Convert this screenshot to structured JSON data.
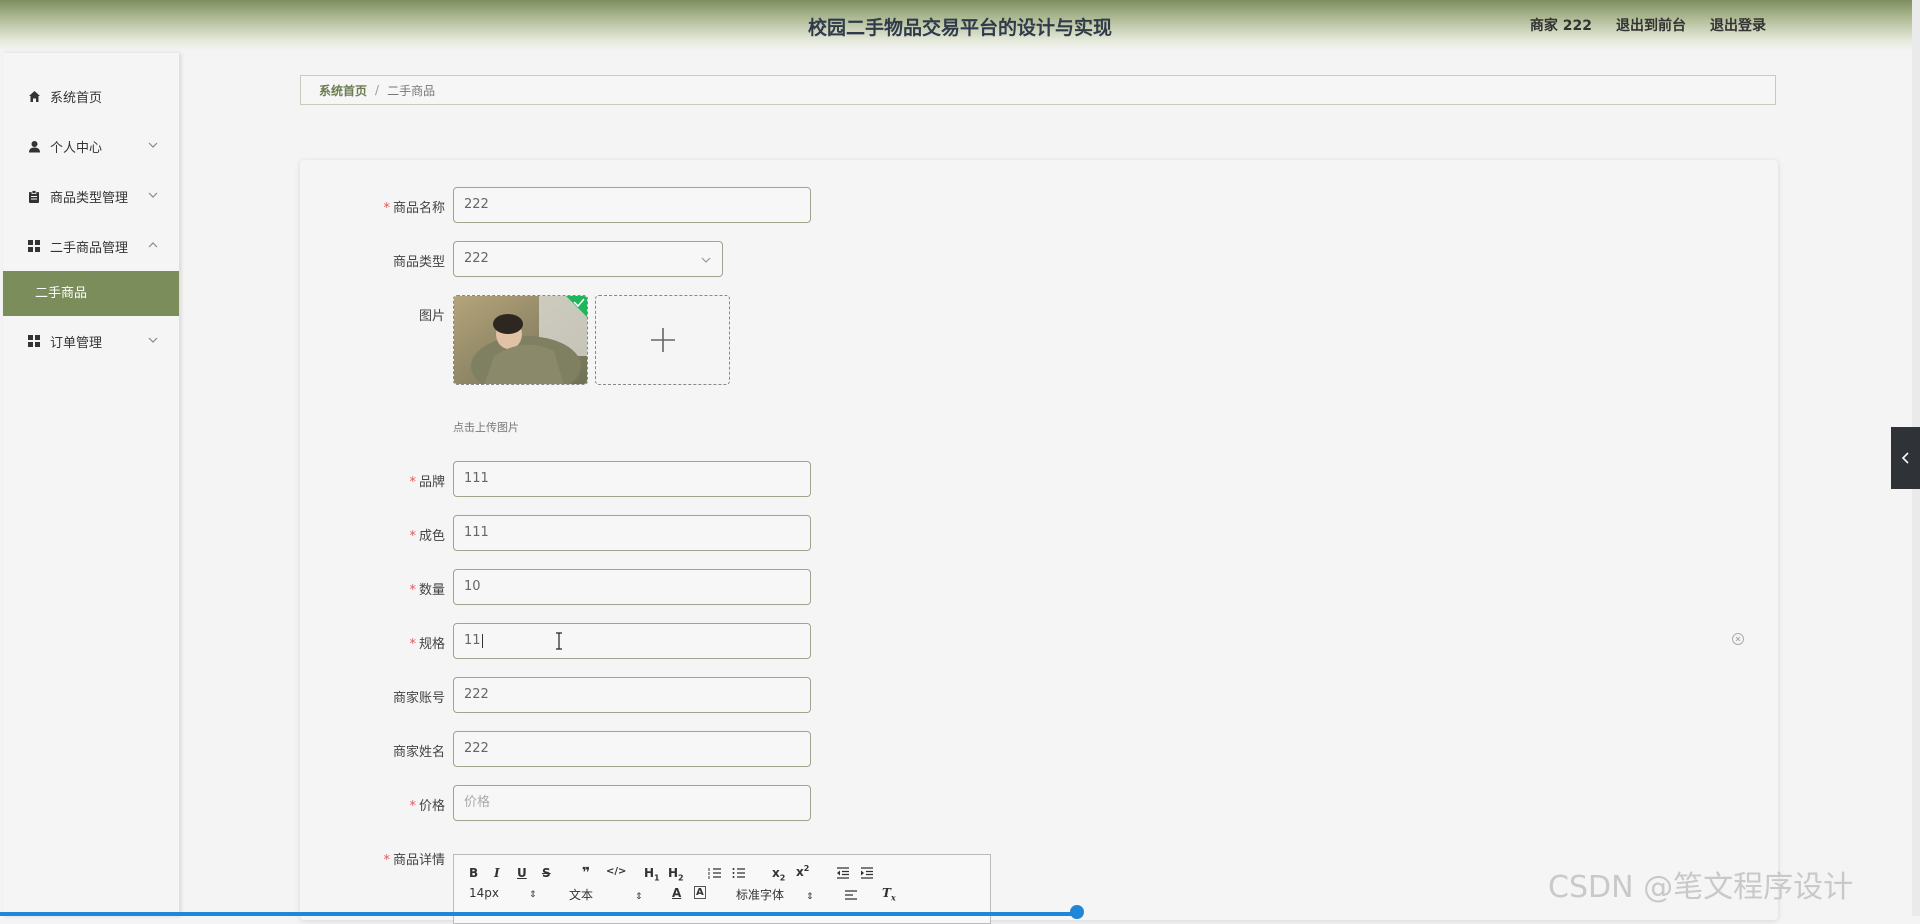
{
  "header": {
    "title": "校园二手物品交易平台的设计与实现",
    "user_label": "商家 222",
    "back_front": "退出到前台",
    "logout": "退出登录"
  },
  "sidebar": {
    "items": [
      {
        "label": "系统首页",
        "icon": "home-icon"
      },
      {
        "label": "个人中心",
        "icon": "user-icon"
      },
      {
        "label": "商品类型管理",
        "icon": "clipboard-icon"
      },
      {
        "label": "二手商品管理",
        "icon": "grid-icon"
      },
      {
        "label": "订单管理",
        "icon": "grid-icon"
      }
    ],
    "active_sub": "二手商品"
  },
  "breadcrumb": {
    "home": "系统首页",
    "separator": "/",
    "current": "二手商品"
  },
  "form": {
    "name": {
      "label": "商品名称",
      "value": "222"
    },
    "type": {
      "label": "商品类型",
      "value": "222"
    },
    "image": {
      "label": "图片",
      "hint": "点击上传图片"
    },
    "brand": {
      "label": "品牌",
      "value": "111"
    },
    "condition": {
      "label": "成色",
      "value": "111"
    },
    "quantity": {
      "label": "数量",
      "value": "10"
    },
    "spec": {
      "label": "规格",
      "value": "11"
    },
    "merchant_account": {
      "label": "商家账号",
      "value": "222"
    },
    "merchant_name": {
      "label": "商家姓名",
      "value": "222"
    },
    "price": {
      "label": "价格",
      "placeholder": "价格"
    },
    "detail": {
      "label": "商品详情"
    }
  },
  "editor": {
    "font_size": "14px",
    "text_style": "文本",
    "font_family": "标准字体"
  },
  "watermark": "CSDN @笔文程序设计",
  "colors": {
    "accent": "#7c8d5c",
    "required": "#e45656"
  }
}
